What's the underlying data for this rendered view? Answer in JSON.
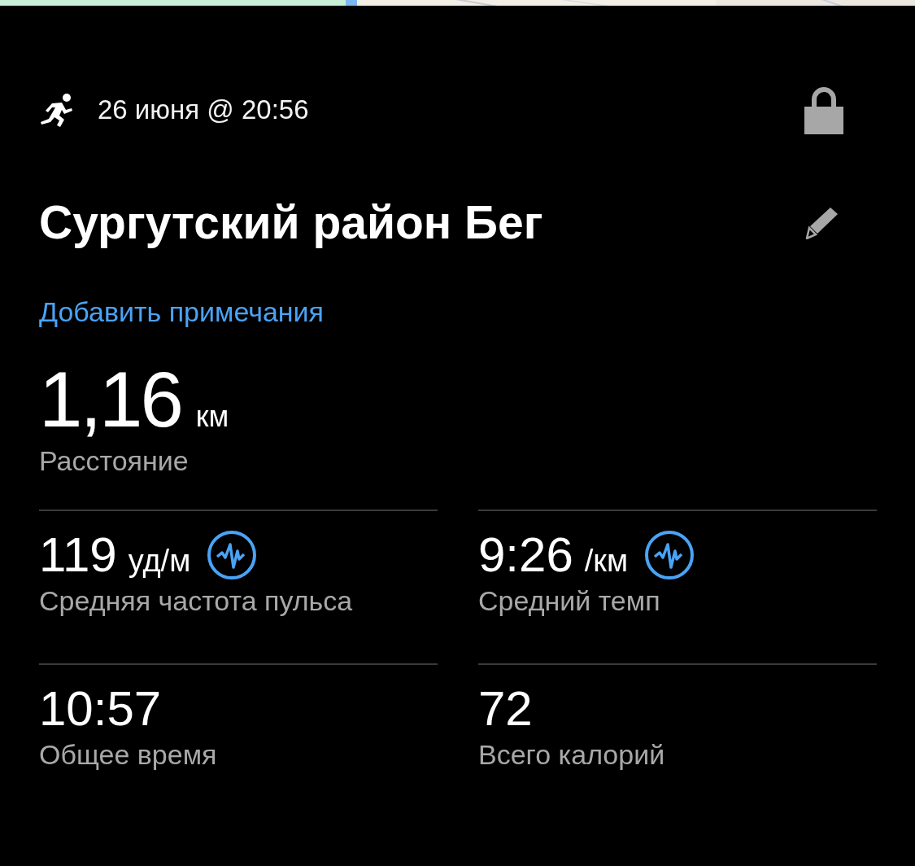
{
  "header": {
    "date": "26 июня @ 20:56"
  },
  "title": "Сургутский район Бег",
  "notes_link": "Добавить примечания",
  "distance": {
    "value": "1,16",
    "unit": "км",
    "label": "Расстояние"
  },
  "stats": [
    {
      "value": "119",
      "unit": "уд/м",
      "label": "Средняя частота пульса",
      "chart_badge": true
    },
    {
      "value": "9:26",
      "unit": "/км",
      "label": "Средний темп",
      "chart_badge": true
    },
    {
      "value": "10:57",
      "label": "Общее время",
      "chart_badge": false
    },
    {
      "value": "72",
      "label": "Всего калорий",
      "chart_badge": false
    }
  ]
}
